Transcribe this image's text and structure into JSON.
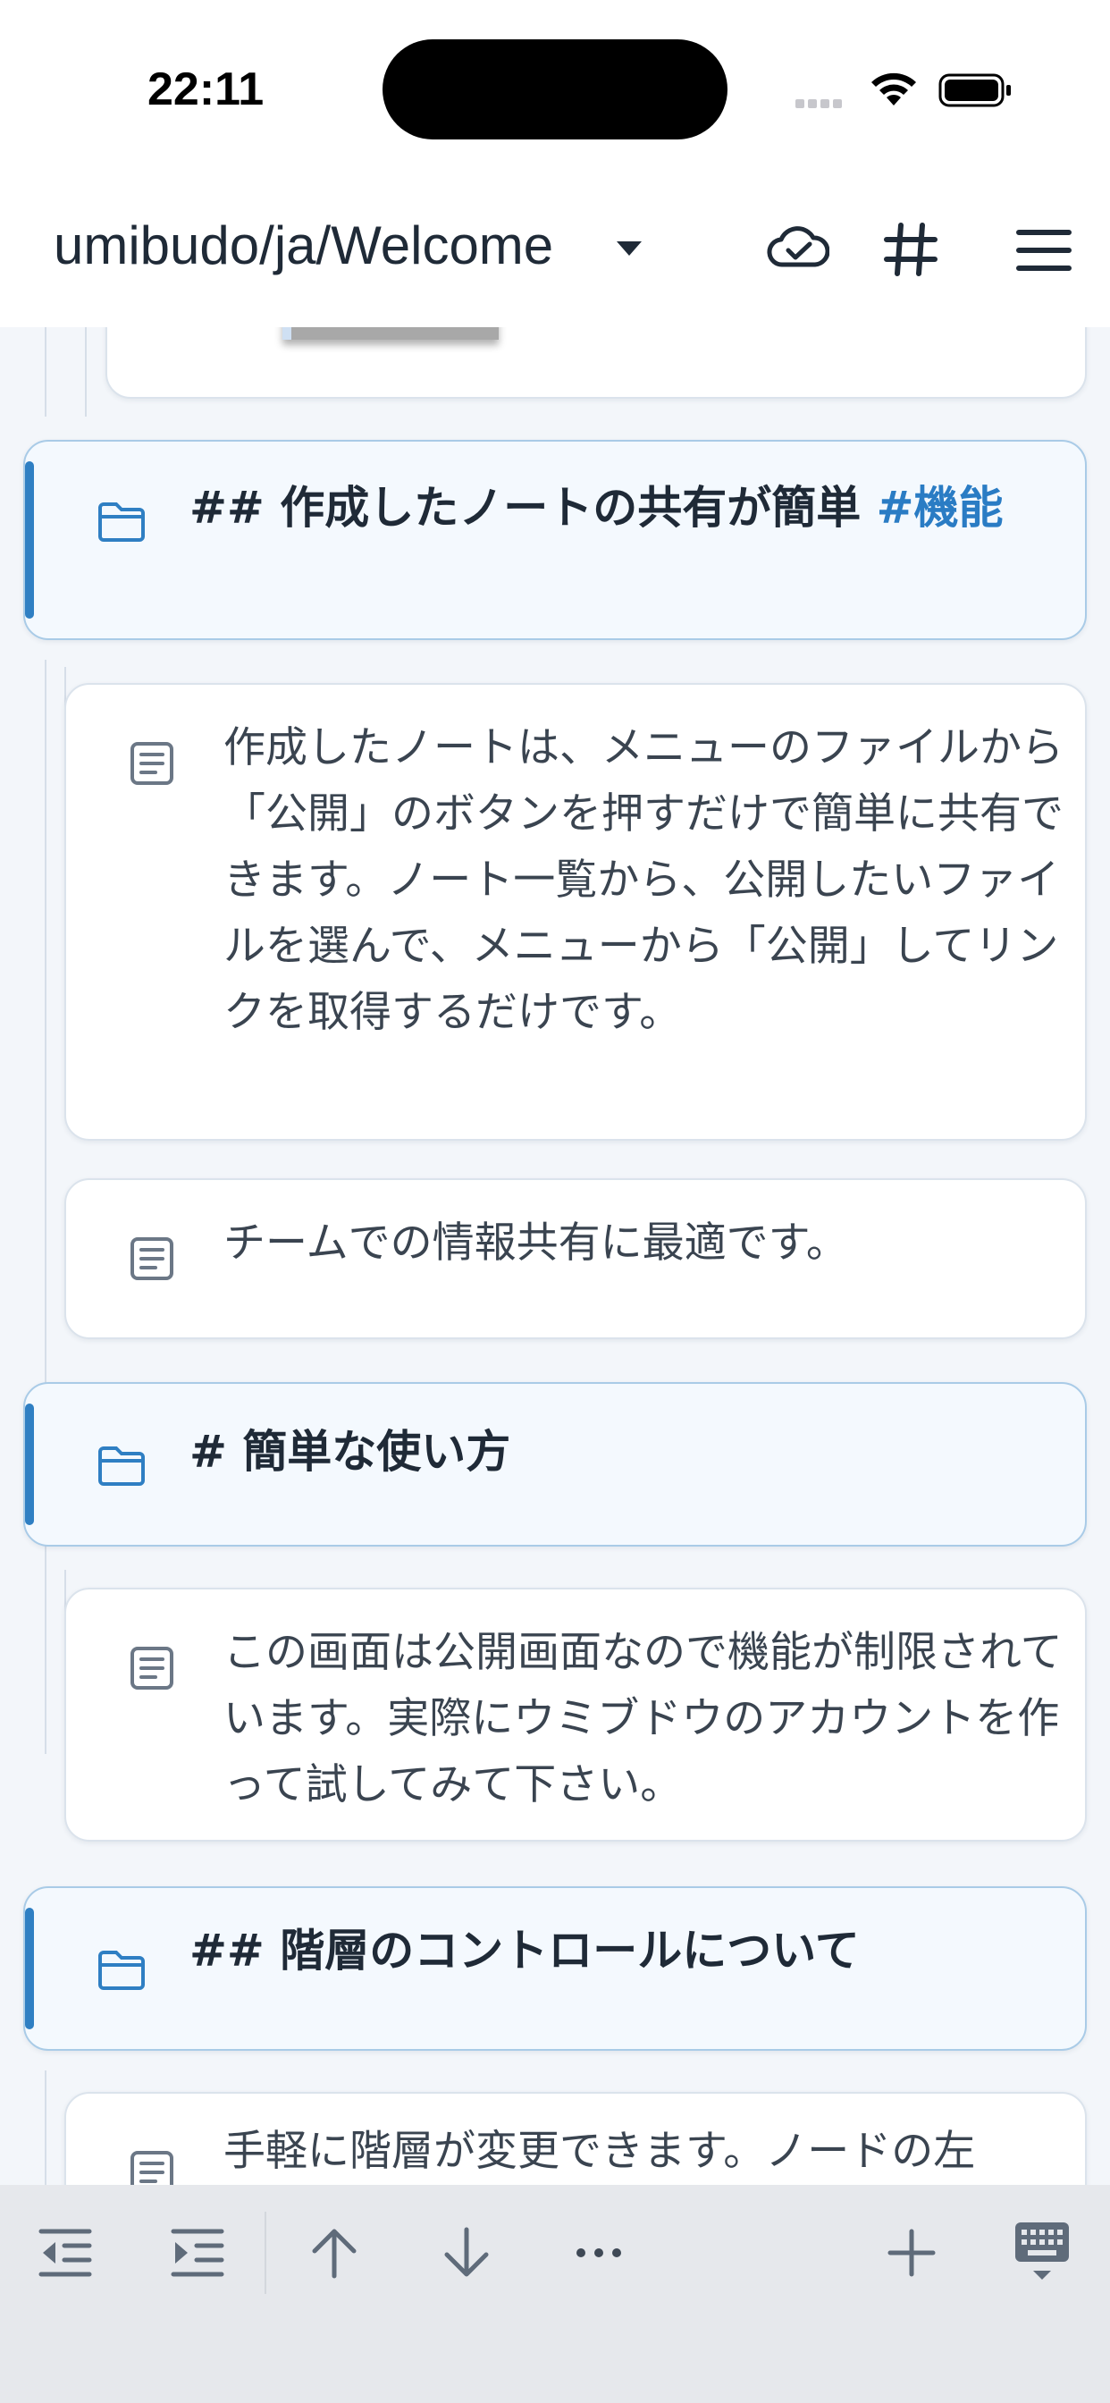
{
  "status_bar": {
    "time": "22:11"
  },
  "header": {
    "title": "umibudo/ja/Welcome"
  },
  "nodes": [
    {
      "type": "heading",
      "prefix": "## ",
      "text": "作成したノートの共有が簡単 ",
      "tag": "#機能"
    },
    {
      "type": "note",
      "text": "作成したノートは、メニューのファイルから「公開」のボタンを押すだけで簡単に共有できます。ノート一覧から、公開したいファイルを選んで、メニューから「公開」してリンクを取得するだけです。"
    },
    {
      "type": "note",
      "text": "チームでの情報共有に最適です。"
    },
    {
      "type": "heading",
      "prefix": "# ",
      "text": "簡単な使い方"
    },
    {
      "type": "note",
      "text": "この画面は公開画面なので機能が制限されています。実際にウミブドウのアカウントを作って試してみて下さい。"
    },
    {
      "type": "heading",
      "prefix": "## ",
      "text": "階層のコントロールについて"
    },
    {
      "type": "note",
      "text": "手軽に階層が変更できます。ノードの左"
    }
  ],
  "toolbar": {
    "icons": [
      "outdent-icon",
      "indent-icon",
      "arrow-up-icon",
      "arrow-down-icon",
      "more-icon",
      "plus-icon",
      "keyboard-hide-icon"
    ]
  },
  "colors": {
    "accent": "#2f7fc3",
    "tag": "#2a7cc4",
    "heading_bg": "#f4f9fe",
    "toolbar_bg": "#e6e8ec"
  }
}
